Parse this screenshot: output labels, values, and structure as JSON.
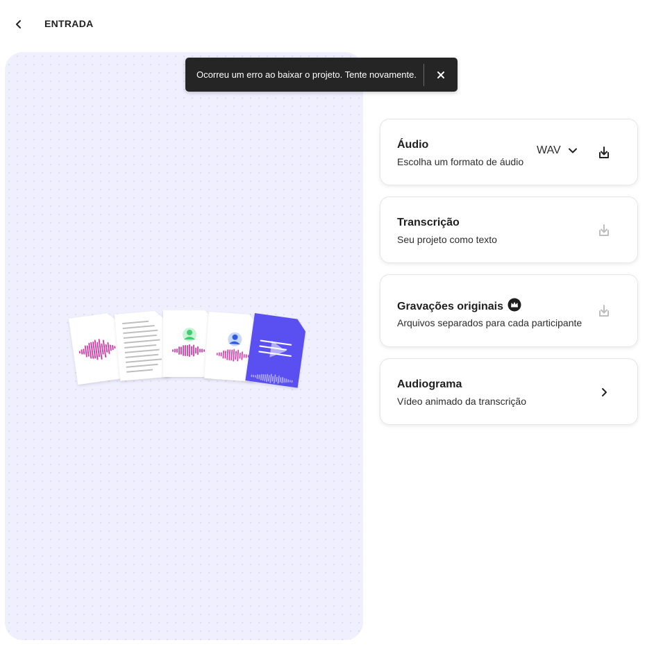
{
  "header": {
    "back_icon": "chevron-left-icon",
    "title": "ENTRADA"
  },
  "toast": {
    "message": "Ocorreu um erro ao baixar o projeto. Tente novamente.",
    "close_icon": "close-icon"
  },
  "preview": {
    "illustration": "export-files-illustration",
    "colors": {
      "background": "#efeffe",
      "waveform": "#d63bac",
      "video_card": "#5a4ff0",
      "avatar_green": "#3fcf6f",
      "avatar_blue": "#4a6fe0"
    }
  },
  "export_options": [
    {
      "title": "Áudio",
      "subtitle": "Escolha um formato de áudio",
      "format": "WAV",
      "dropdown_icon": "chevron-down-icon",
      "action_icon": "download-icon",
      "action_enabled": true
    },
    {
      "title": "Transcrição",
      "subtitle": "Seu projeto como texto",
      "action_icon": "download-icon",
      "action_enabled": false
    },
    {
      "title": "Gravações originais",
      "badge_icon": "premium-crown-icon",
      "subtitle": "Arquivos separados para cada participante",
      "action_icon": "download-icon",
      "action_enabled": false
    },
    {
      "title": "Audiograma",
      "subtitle": "Vídeo animado da transcrição",
      "action_icon": "chevron-right-icon",
      "action_enabled": true
    }
  ]
}
